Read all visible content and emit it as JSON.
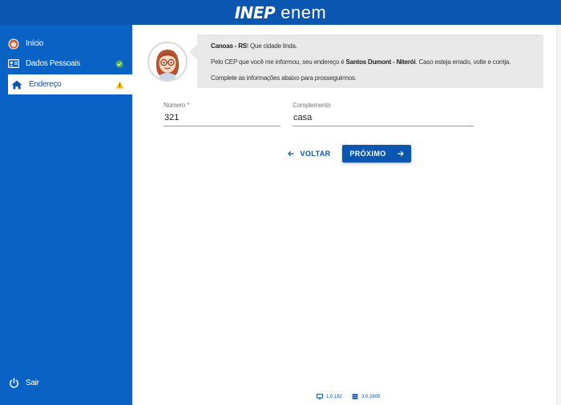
{
  "header": {
    "logo_inep": "INEP",
    "logo_enem": "enem"
  },
  "sidebar": {
    "items": [
      {
        "label": "Início",
        "icon": "avatar-icon"
      },
      {
        "label": "Dados Pessoais",
        "icon": "id-card-icon",
        "status": "check-circle-icon"
      },
      {
        "label": "Endereço",
        "icon": "home-icon",
        "status": "warning-icon",
        "active": true
      }
    ],
    "logout": {
      "label": "Sair",
      "icon": "power-icon"
    }
  },
  "message": {
    "line1_bold": "Canoas - RS",
    "line1_rest": "! Que cidade linda.",
    "line2_pre": "Pelo CEP que você me informou, seu endereço é ",
    "line2_bold": "Santos Dumont - Niterói",
    "line2_post": ". Caso esteja errado, volte e corrija.",
    "line3": "Complete as informações abaixo para prosseguirmos."
  },
  "form": {
    "numero": {
      "label": "Número *",
      "value": "321"
    },
    "complemento": {
      "label": "Complemento",
      "value": "casa"
    }
  },
  "actions": {
    "back_label": "VOLTAR",
    "next_label": "PRÓXIMO"
  },
  "footer": {
    "frontend_version": "1.0.182",
    "backend_version": "3.0.2805"
  },
  "colors": {
    "primary": "#0a56b0",
    "sidebar": "#0a62c4",
    "success": "#4caf50",
    "warning": "#f5c518"
  }
}
